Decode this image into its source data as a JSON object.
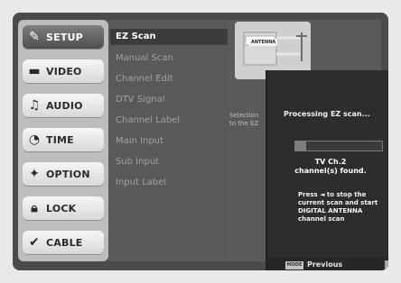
{
  "nav": {
    "items": [
      {
        "label": "SETUP",
        "icon": "wrench-icon",
        "glyph": "✎"
      },
      {
        "label": "VIDEO",
        "icon": "tv-icon",
        "glyph": "▬"
      },
      {
        "label": "AUDIO",
        "icon": "speaker-icon",
        "glyph": "♫"
      },
      {
        "label": "TIME",
        "icon": "clock-icon",
        "glyph": "◔"
      },
      {
        "label": "OPTION",
        "icon": "option-icon",
        "glyph": "✦"
      },
      {
        "label": "LOCK",
        "icon": "lock-icon",
        "glyph": "🔒︎"
      },
      {
        "label": "CABLE",
        "icon": "check-icon",
        "glyph": "✔"
      }
    ]
  },
  "setup_menu": {
    "items": [
      {
        "label": "EZ Scan"
      },
      {
        "label": "Manual Scan"
      },
      {
        "label": "Channel Edit"
      },
      {
        "label": "DTV Signal"
      },
      {
        "label": "Channel Label"
      },
      {
        "label": "Main Input"
      },
      {
        "label": "Sub Input"
      },
      {
        "label": "Input Label"
      }
    ]
  },
  "diagram": {
    "antenna_label": "ANTENNA"
  },
  "help": {
    "text_line1": "Selection",
    "text_line2": "to the EZ"
  },
  "dialog": {
    "title": "Processing EZ scan...",
    "progress": 0.12,
    "found_line1": "TV Ch.2",
    "found_line2": "channel(s) found.",
    "instructions": "Press ◄ to stop the current scan and start DIGITAL ANTENNA channel scan"
  },
  "footer": {
    "mode_button": "MODE",
    "previous_label": "Previous"
  },
  "colors": {
    "active_nav": "#5b5b5b",
    "inactive_nav": "#e9e9e9",
    "menu_active_text": "#ffffff",
    "menu_inactive_text": "#a2a2a2"
  }
}
